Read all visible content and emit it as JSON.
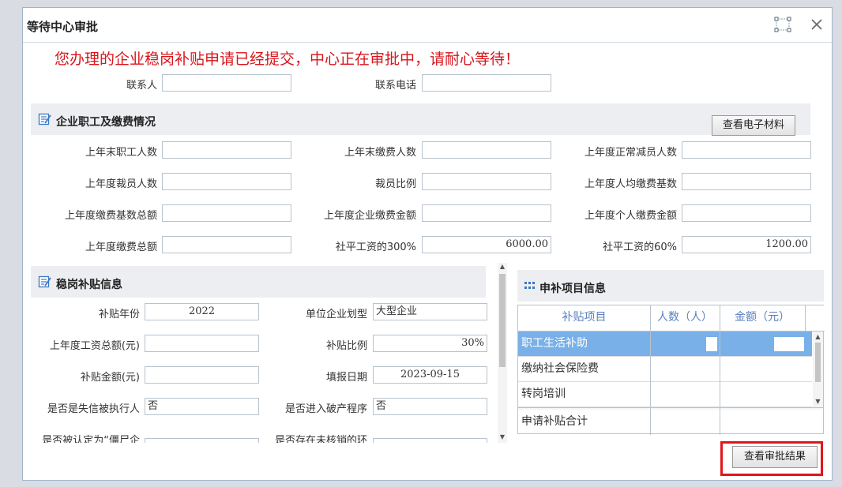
{
  "dialog": {
    "title": "等待中心审批",
    "notice": "您办理的企业稳岗补贴申请已经提交，中心正在审批中，请耐心等待！"
  },
  "contact": {
    "person_label": "联系人",
    "person_value": "",
    "phone_label": "联系电话",
    "phone_value": ""
  },
  "staff_section": {
    "title": "企业职工及缴费情况",
    "view_materials_button": "查看电子材料",
    "fields": [
      {
        "label": "上年末职工人数",
        "value": ""
      },
      {
        "label": "上年末缴费人数",
        "value": ""
      },
      {
        "label": "上年度正常减员人数",
        "value": ""
      },
      {
        "label": "上年度裁员人数",
        "value": ""
      },
      {
        "label": "裁员比例",
        "value": ""
      },
      {
        "label": "上年度人均缴费基数",
        "value": ""
      },
      {
        "label": "上年度缴费基数总额",
        "value": ""
      },
      {
        "label": "上年度企业缴费金额",
        "value": ""
      },
      {
        "label": "上年度个人缴费金额",
        "value": ""
      },
      {
        "label": "上年度缴费总额",
        "value": ""
      },
      {
        "label": "社平工资的300%",
        "value": "6000.00"
      },
      {
        "label": "社平工资的60%",
        "value": "1200.00"
      }
    ]
  },
  "subsidy_section": {
    "title": "稳岗补贴信息",
    "fields": [
      {
        "label": "补贴年份",
        "value": "2022"
      },
      {
        "label": "单位企业划型",
        "value": "大型企业"
      },
      {
        "label": "上年度工资总额(元)",
        "value": ""
      },
      {
        "label": "补贴比例",
        "value": "30%"
      },
      {
        "label": "补贴金额(元)",
        "value": ""
      },
      {
        "label": "填报日期",
        "value": "2023-09-15"
      },
      {
        "label": "是否是失信被执行人",
        "value": "否"
      },
      {
        "label": "是否进入破产程序",
        "value": "否"
      },
      {
        "label": "是否被认定为“僵尸企",
        "value": ""
      },
      {
        "label": "是否存在未核销的环",
        "value": ""
      }
    ]
  },
  "items_section": {
    "title": "申补项目信息",
    "headers": [
      "补贴项目",
      "人数（人）",
      "金额（元）"
    ],
    "rows": [
      {
        "name": "职工生活补助",
        "count": "",
        "amount": ""
      },
      {
        "name": "缴纳社会保险费",
        "count": "",
        "amount": ""
      },
      {
        "name": "转岗培训",
        "count": "",
        "amount": ""
      }
    ],
    "total_label": "申请补贴合计",
    "total_count": "",
    "total_amount": ""
  },
  "footer": {
    "view_result_button": "查看审批结果"
  },
  "colors": {
    "notice": "#d9151b",
    "accent": "#3a78c3",
    "selected_row": "#79b0e8",
    "highlight": "#e0151d"
  }
}
